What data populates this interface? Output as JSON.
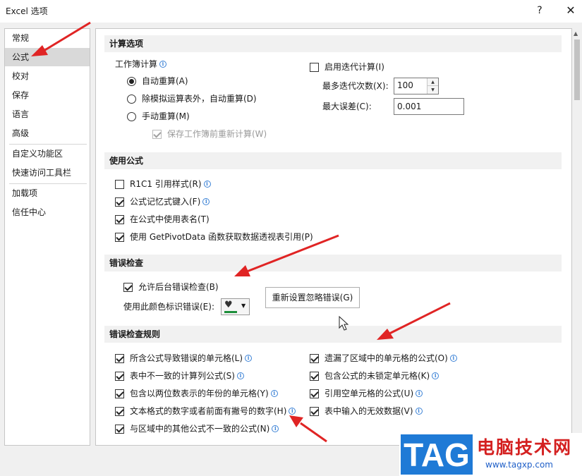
{
  "window": {
    "title": "Excel 选项",
    "help": "?",
    "close": "✕"
  },
  "nav": {
    "items": [
      "常规",
      "公式",
      "校对",
      "保存",
      "语言",
      "高级",
      "自定义功能区",
      "快速访问工具栏",
      "加载项",
      "信任中心"
    ],
    "active": "公式"
  },
  "calc": {
    "header": "计算选项",
    "workbook_label": "工作簿计算",
    "auto": "自动重算(A)",
    "auto_except": "除模拟运算表外，自动重算(D)",
    "manual": "手动重算(M)",
    "recalc_before_save": "保存工作簿前重新计算(W)",
    "iterative": "启用迭代计算(I)",
    "max_iter_label": "最多迭代次数(X):",
    "max_iter_value": "100",
    "max_change_label": "最大误差(C):",
    "max_change_value": "0.001"
  },
  "formulas": {
    "header": "使用公式",
    "r1c1": "R1C1 引用样式(R)",
    "autocomplete": "公式记忆式键入(F)",
    "table_names": "在公式中使用表名(T)",
    "getpivot": "使用 GetPivotData 函数获取数据透视表引用(P)"
  },
  "errorcheck": {
    "header": "错误检查",
    "background": "允许后台错误检查(B)",
    "color_label": "使用此颜色标识错误(E):",
    "reset_button": "重新设置忽略错误(G)"
  },
  "rules": {
    "header": "错误检查规则",
    "left": [
      "所含公式导致错误的单元格(L)",
      "表中不一致的计算列公式(S)",
      "包含以两位数表示的年份的单元格(Y)",
      "文本格式的数字或者前面有撇号的数字(H)",
      "与区域中的其他公式不一致的公式(N)"
    ],
    "right": [
      "遗漏了区域中的单元格的公式(O)",
      "包含公式的未锁定单元格(K)",
      "引用空单元格的公式(U)",
      "表中输入的无效数据(V)"
    ]
  },
  "colors": {
    "accent_arrow": "#e02424",
    "error_indicator": "#1e8f3c",
    "watermark_blue": "#1f7ad6",
    "watermark_red": "#d42020"
  },
  "watermark": {
    "tag": "TAG",
    "site": "电脑技术网",
    "url": "www.tagxp.com"
  }
}
